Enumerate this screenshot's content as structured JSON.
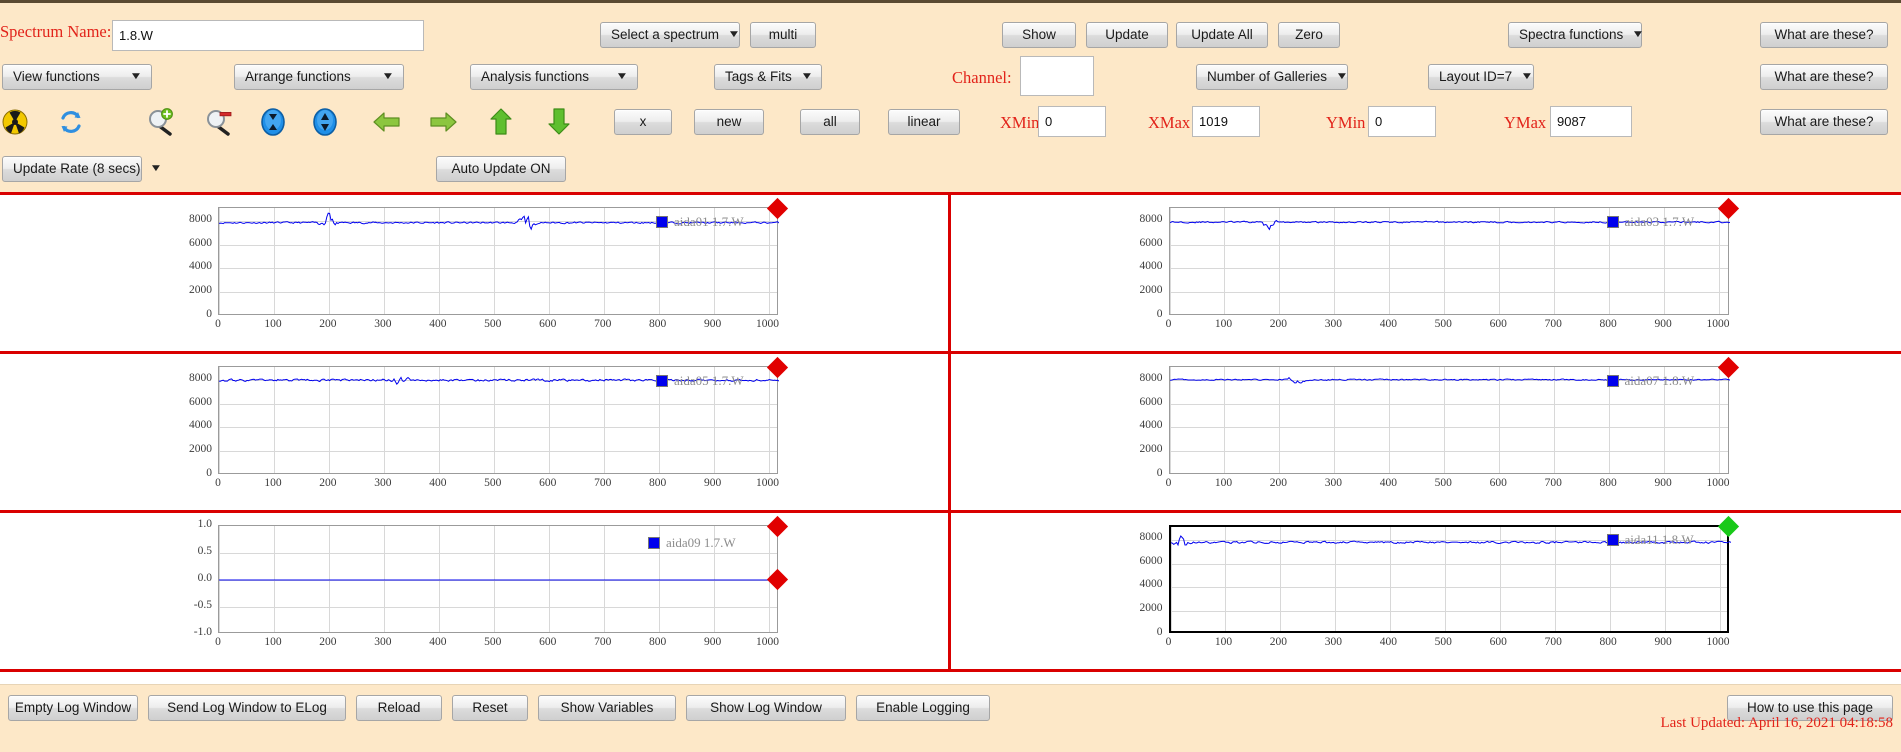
{
  "toolbar": {
    "spectrum_name_label": "Spectrum Name:",
    "spectrum_name_value": "1.8.W",
    "select_spectrum": "Select a spectrum",
    "multi": "multi",
    "show": "Show",
    "update": "Update",
    "update_all": "Update All",
    "zero": "Zero",
    "spectra_functions": "Spectra functions",
    "what_are_these_1": "What are these?",
    "view_functions": "View functions",
    "arrange_functions": "Arrange functions",
    "analysis_functions": "Analysis functions",
    "tags_fits": "Tags & Fits",
    "channel_label": "Channel:",
    "channel_value": "",
    "number_of_galleries": "Number of Galleries",
    "layout_id": "Layout ID=7",
    "what_are_these_2": "What are these?",
    "x_button": "x",
    "new_button": "new",
    "all_button": "all",
    "linear_button": "linear",
    "xmin_label": "XMin",
    "xmin_value": "0",
    "xmax_label": "XMax",
    "xmax_value": "1019",
    "ymin_label": "YMin",
    "ymin_value": "0",
    "ymax_label": "YMax",
    "ymax_value": "9087",
    "what_are_these_3": "What are these?",
    "update_rate": "Update Rate (8 secs)",
    "auto_update": "Auto Update ON",
    "icons": [
      "radiation-icon",
      "refresh-icon",
      "zoom-in-icon",
      "zoom-out-icon",
      "expand-vertical-icon",
      "collapse-vertical-icon",
      "arrow-left-icon",
      "arrow-right-icon",
      "arrow-up-icon",
      "arrow-down-icon"
    ]
  },
  "bottom": {
    "empty_log_window": "Empty Log Window",
    "send_log_window": "Send Log Window to ELog",
    "reload": "Reload",
    "reset": "Reset",
    "show_variables": "Show Variables",
    "show_log_window": "Show Log Window",
    "enable_logging": "Enable Logging",
    "how_to_use": "How to use this page",
    "last_updated": "Last Updated: April 16, 2021 04:18:58"
  },
  "colors": {
    "toolbar_bg": "#fde8c8",
    "divider_red": "#d90000",
    "label_red": "#e2231a",
    "trace_blue": "#0000ee",
    "marker_red": "#e10000",
    "marker_green": "#19c919"
  },
  "chart_data": [
    {
      "type": "line",
      "title": "aida01 1.7.W",
      "legend": "aida01 1.7.W",
      "xlabel": "",
      "ylabel": "",
      "xlim": [
        0,
        1019
      ],
      "ylim": [
        0,
        9087
      ],
      "xticks": [
        0,
        100,
        200,
        300,
        400,
        500,
        600,
        700,
        800,
        900,
        1000
      ],
      "yticks": [
        0,
        2000,
        4000,
        6000,
        8000
      ],
      "grid": true,
      "marker": "red-diamond",
      "baseline": 7850,
      "noise": 110,
      "spikes": [
        {
          "x": 200,
          "amp": 700
        },
        {
          "x": 560,
          "amp": 650
        }
      ],
      "seed": 11
    },
    {
      "type": "line",
      "title": "aida03 1.7.W",
      "legend": "aida03 1.7.W",
      "xlabel": "",
      "ylabel": "",
      "xlim": [
        0,
        1019
      ],
      "ylim": [
        0,
        9087
      ],
      "xticks": [
        0,
        100,
        200,
        300,
        400,
        500,
        600,
        700,
        800,
        900,
        1000
      ],
      "yticks": [
        0,
        2000,
        4000,
        6000,
        8000
      ],
      "grid": true,
      "marker": "red-diamond",
      "baseline": 7900,
      "noise": 95,
      "spikes": [
        {
          "x": 180,
          "amp": 420
        }
      ],
      "seed": 29
    },
    {
      "type": "line",
      "title": "aida05 1.7.W",
      "legend": "aida05 1.7.W",
      "xlabel": "",
      "ylabel": "",
      "xlim": [
        0,
        1019
      ],
      "ylim": [
        0,
        9087
      ],
      "xticks": [
        0,
        100,
        200,
        300,
        400,
        500,
        600,
        700,
        800,
        900,
        1000
      ],
      "yticks": [
        0,
        2000,
        4000,
        6000,
        8000
      ],
      "grid": true,
      "marker": "red-diamond",
      "baseline": 7980,
      "noise": 150,
      "spikes": [
        {
          "x": 330,
          "amp": 380
        }
      ],
      "seed": 47
    },
    {
      "type": "line",
      "title": "aida07 1.8.W",
      "legend": "aida07 1.8.W",
      "xlabel": "",
      "ylabel": "",
      "xlim": [
        0,
        1019
      ],
      "ylim": [
        0,
        9087
      ],
      "xticks": [
        0,
        100,
        200,
        300,
        400,
        500,
        600,
        700,
        800,
        900,
        1000
      ],
      "yticks": [
        0,
        2000,
        4000,
        6000,
        8000
      ],
      "grid": true,
      "marker": "red-diamond",
      "baseline": 8020,
      "noise": 80,
      "spikes": [
        {
          "x": 230,
          "amp": 300
        }
      ],
      "seed": 63
    },
    {
      "type": "line",
      "title": "aida09 1.7.W",
      "legend": "aida09 1.7.W",
      "xlabel": "",
      "ylabel": "",
      "xlim": [
        0,
        1019
      ],
      "ylim": [
        -1.0,
        1.0
      ],
      "xticks": [
        0,
        100,
        200,
        300,
        400,
        500,
        600,
        700,
        800,
        900,
        1000
      ],
      "yticks": [
        -1.0,
        -0.5,
        0.0,
        0.5,
        1.0
      ],
      "ytick_labels": [
        "-1.0",
        "-0.5",
        "0.0",
        "0.5",
        "1.0"
      ],
      "grid": true,
      "marker": "red-diamond",
      "empty": true,
      "flat_value": 0.0,
      "seed": 0
    },
    {
      "type": "line",
      "title": "aida11 1.8.W",
      "legend": "aida11 1.8.W",
      "xlabel": "",
      "ylabel": "",
      "xlim": [
        0,
        1019
      ],
      "ylim": [
        0,
        9087
      ],
      "xticks": [
        0,
        100,
        200,
        300,
        400,
        500,
        600,
        700,
        800,
        900,
        1000
      ],
      "yticks": [
        0,
        2000,
        4000,
        6000,
        8000
      ],
      "grid": true,
      "marker": "green-diamond",
      "selected": true,
      "baseline": 7800,
      "noise": 130,
      "spikes": [
        {
          "x": 20,
          "amp": 500
        }
      ],
      "seed": 83
    }
  ]
}
